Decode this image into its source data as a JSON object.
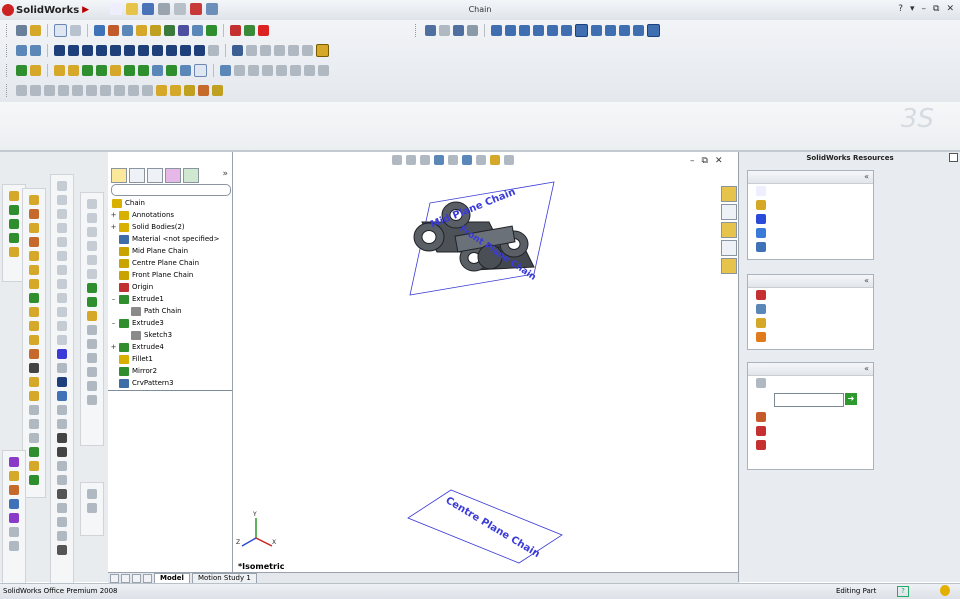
{
  "app": {
    "name": "SolidWorks",
    "doc_title": "Chain"
  },
  "window_controls": {
    "help": "?",
    "dropdown": "▾",
    "minimize": "–",
    "restore": "⧉",
    "close": "✕"
  },
  "feature_tree": {
    "root": "Chain",
    "more_label": "»",
    "nodes": [
      {
        "label": "Annotations",
        "expander": "+",
        "indent": 0,
        "icon": "annotations-icon",
        "color": "#d8b000"
      },
      {
        "label": "Solid Bodies(2)",
        "expander": "+",
        "indent": 0,
        "icon": "solid-bodies-icon",
        "color": "#d8b000"
      },
      {
        "label": "Material <not specified>",
        "expander": "",
        "indent": 0,
        "icon": "material-icon",
        "color": "#3d6ea8"
      },
      {
        "label": "Mid Plane Chain",
        "expander": "",
        "indent": 0,
        "icon": "plane-icon",
        "color": "#c9a400"
      },
      {
        "label": "Centre Plane Chain",
        "expander": "",
        "indent": 0,
        "icon": "plane-icon",
        "color": "#c9a400"
      },
      {
        "label": "Front Plane Chain",
        "expander": "",
        "indent": 0,
        "icon": "plane-icon",
        "color": "#c9a400"
      },
      {
        "label": "Origin",
        "expander": "",
        "indent": 0,
        "icon": "origin-icon",
        "color": "#c03030"
      },
      {
        "label": "Extrude1",
        "expander": "–",
        "indent": 0,
        "icon": "extrude-icon",
        "color": "#2f8f2f"
      },
      {
        "label": "Path Chain",
        "expander": "",
        "indent": 1,
        "icon": "sketch-icon",
        "color": "#8a8a8a"
      },
      {
        "label": "Extrude3",
        "expander": "–",
        "indent": 0,
        "icon": "extrude-icon",
        "color": "#2f8f2f"
      },
      {
        "label": "Sketch3",
        "expander": "",
        "indent": 1,
        "icon": "sketch-icon",
        "color": "#8a8a8a"
      },
      {
        "label": "Extrude4",
        "expander": "+",
        "indent": 0,
        "icon": "extrude-icon",
        "color": "#2f8f2f"
      },
      {
        "label": "Fillet1",
        "expander": "",
        "indent": 0,
        "icon": "fillet-icon",
        "color": "#d8b000"
      },
      {
        "label": "Mirror2",
        "expander": "",
        "indent": 0,
        "icon": "mirror-icon",
        "color": "#2f8f2f"
      },
      {
        "label": "CrvPattern3",
        "expander": "",
        "indent": 0,
        "icon": "curve-pattern-icon",
        "color": "#3d6ea8"
      }
    ]
  },
  "bottom_tabs": [
    {
      "label": "Model",
      "active": true
    },
    {
      "label": "Motion Study 1",
      "active": false
    }
  ],
  "graphics": {
    "view_label": "*Isometric",
    "planes": {
      "mid": "Mid Plane Chain",
      "front": "Front Plane Chain",
      "centre": "Centre Plane Chain"
    },
    "triad": {
      "x": "X",
      "y": "Y",
      "z": "Z"
    }
  },
  "task_pane": {
    "title": "SolidWorks Resources",
    "collapse": "«"
  },
  "status_bar": {
    "product": "SolidWorks Office Premium 2008",
    "mode": "Editing Part",
    "help": "?"
  },
  "colors": {
    "accent": "#c41e1e",
    "plane_text": "#3a3ad8",
    "tree_selected": "#3163c5"
  }
}
